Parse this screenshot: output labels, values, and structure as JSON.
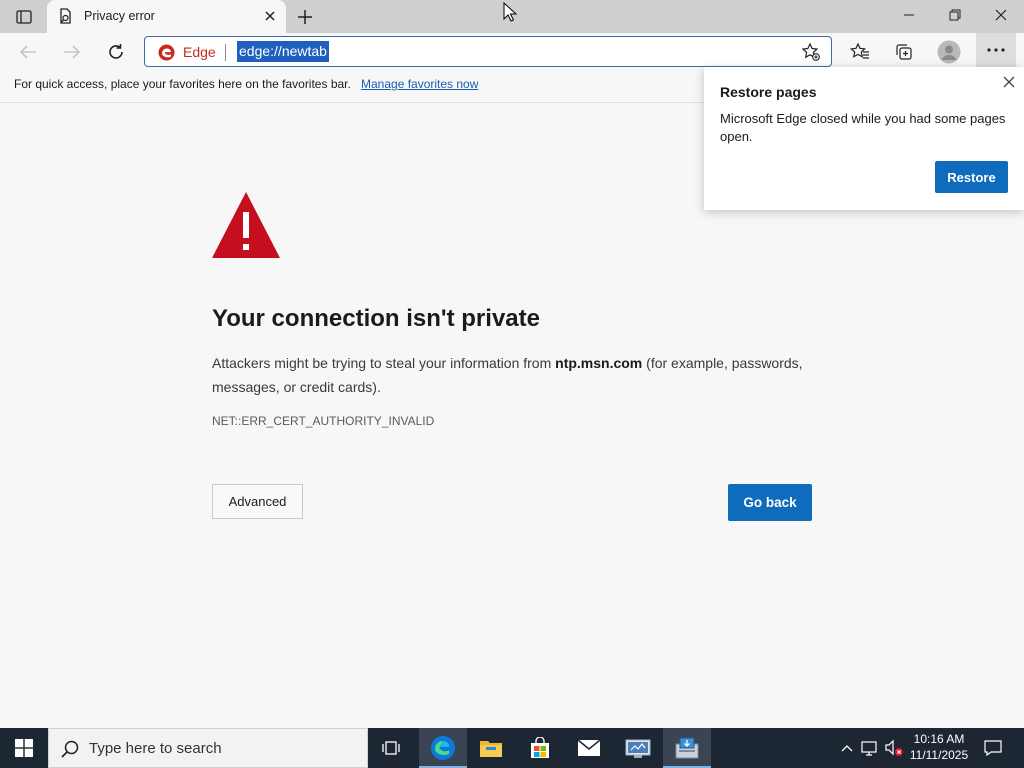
{
  "browser": {
    "tab_title": "Privacy error",
    "address_label": "Edge",
    "address_url": "edge://newtab"
  },
  "favorites_bar": {
    "message": "For quick access, place your favorites here on the favorites bar.",
    "link": "Manage favorites now"
  },
  "error_page": {
    "heading": "Your connection isn't private",
    "desc_before": "Attackers might be trying to steal your information from ",
    "desc_host": "ntp.msn.com",
    "desc_after": " (for example, passwords, messages, or credit cards).",
    "error_code": "NET::ERR_CERT_AUTHORITY_INVALID",
    "advanced_label": "Advanced",
    "go_back_label": "Go back",
    "warning_color": "#c50f1f"
  },
  "restore_popup": {
    "title": "Restore pages",
    "message": "Microsoft Edge closed while you had some pages open.",
    "button": "Restore"
  },
  "taskbar": {
    "search_placeholder": "Type here to search",
    "time": "10:16 AM",
    "date": "11/11/2025",
    "apps": [
      "task-view",
      "edge",
      "file-explorer",
      "store",
      "mail",
      "network-app",
      "installer-app"
    ]
  },
  "accent_color": "#0f6cbd"
}
